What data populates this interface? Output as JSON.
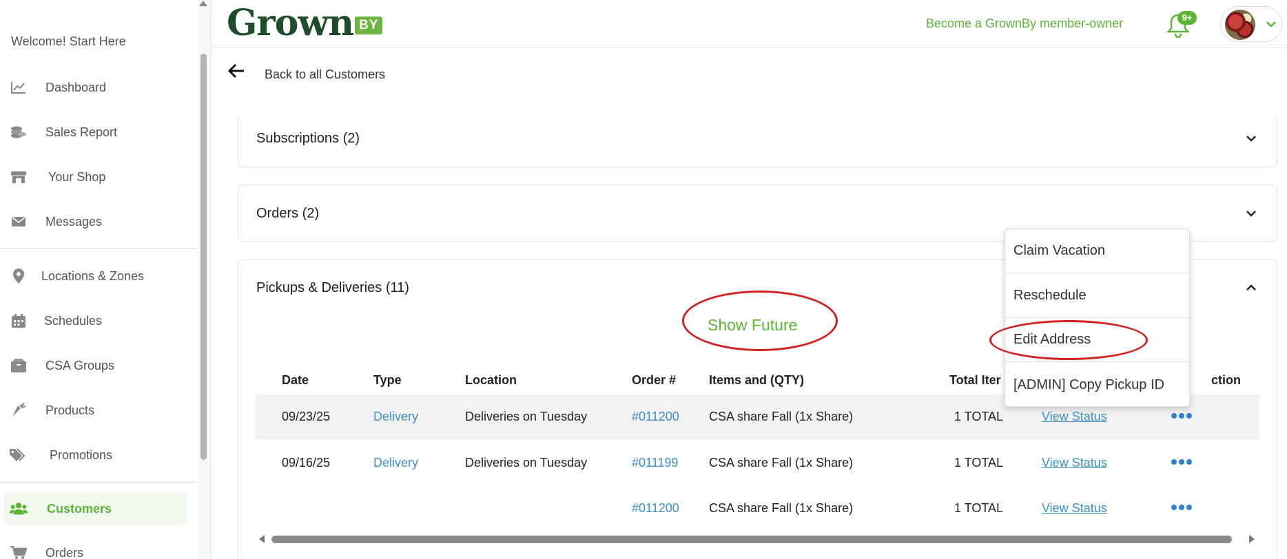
{
  "sidebar": {
    "welcome": "Welcome! Start Here",
    "items": [
      {
        "label": "Dashboard",
        "icon": "chart-line-icon"
      },
      {
        "label": "Sales Report",
        "icon": "coins-icon"
      },
      {
        "label": "Your Shop",
        "icon": "store-icon"
      },
      {
        "label": "Messages",
        "icon": "envelope-icon"
      },
      {
        "label": "Locations & Zones",
        "icon": "map-pin-icon"
      },
      {
        "label": "Schedules",
        "icon": "calendar-icon"
      },
      {
        "label": "CSA Groups",
        "icon": "box-icon"
      },
      {
        "label": "Products",
        "icon": "carrot-icon"
      },
      {
        "label": "Promotions",
        "icon": "tags-icon"
      },
      {
        "label": "Customers",
        "icon": "users-icon",
        "active": true
      },
      {
        "label": "Orders",
        "icon": "cart-icon"
      }
    ]
  },
  "header": {
    "logo_main": "Grown",
    "logo_by": "BY",
    "member_link": "Become a GrownBy member-owner",
    "notification_badge": "9+"
  },
  "back_label": "Back to all Customers",
  "sections": {
    "subscriptions": "Subscriptions (2)",
    "orders": "Orders (2)",
    "pickups": "Pickups & Deliveries (11)"
  },
  "show_future": "Show Future",
  "table": {
    "headers": [
      "Date",
      "Type",
      "Location",
      "Order #",
      "Items and (QTY)",
      "Total Iter",
      "ction"
    ],
    "rows": [
      {
        "date": "09/23/25",
        "type": "Delivery",
        "location": "Deliveries on Tuesday",
        "order": "#011200",
        "items": "CSA share Fall (1x Share)",
        "total": "1 TOTAL",
        "status": "View Status"
      },
      {
        "date": "09/16/25",
        "type": "Delivery",
        "location": "Deliveries on Tuesday",
        "order": "#011199",
        "items": "CSA share Fall (1x Share)",
        "total": "1 TOTAL",
        "status": "View Status"
      },
      {
        "date": "",
        "type": "",
        "location": "",
        "order": "#011200",
        "items": "CSA share Fall (1x Share)",
        "total": "1 TOTAL",
        "status": "View Status"
      }
    ]
  },
  "menu": {
    "items": [
      "Claim Vacation",
      "Reschedule",
      "Edit Address",
      "[ADMIN] Copy Pickup ID"
    ]
  },
  "colors": {
    "accent_green": "#5ab534",
    "logo_dark_green": "#1f4d2a",
    "link_blue": "#3b8fce",
    "annotation_red": "#d42020"
  }
}
